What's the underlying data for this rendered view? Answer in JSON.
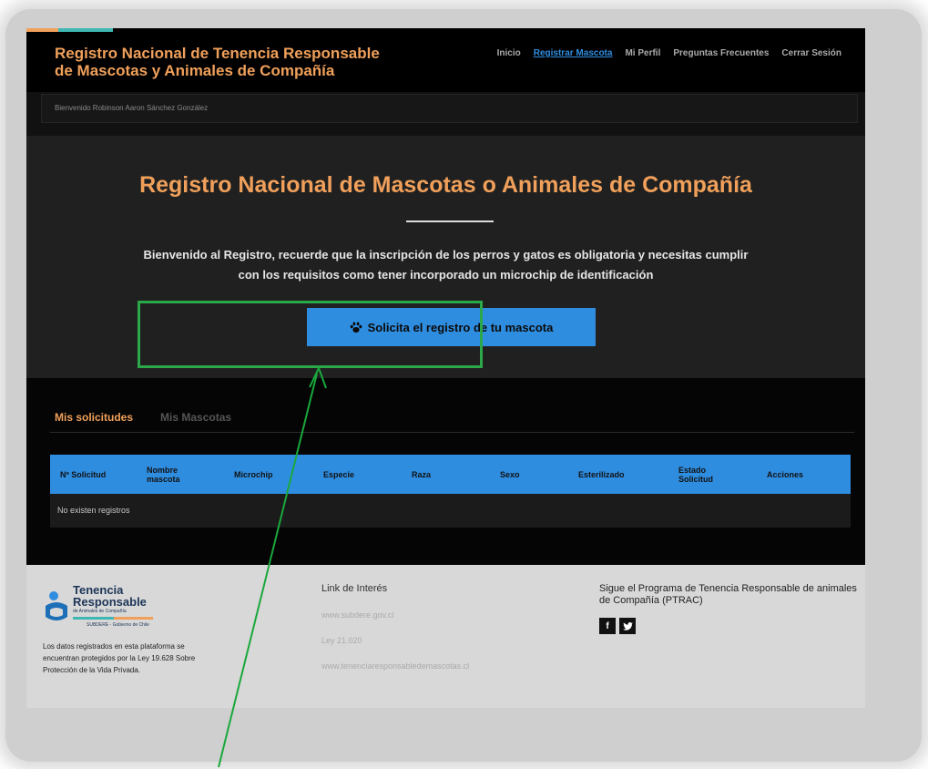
{
  "header": {
    "brand": "Registro Nacional de Tenencia Responsable\nde Mascotas y Animales de Compañía",
    "nav": [
      {
        "label": "Inicio",
        "active": false
      },
      {
        "label": "Registrar Mascota",
        "active": true
      },
      {
        "label": "Mi Perfil",
        "active": false
      },
      {
        "label": "Preguntas Frecuentes",
        "active": false
      },
      {
        "label": "Cerrar Sesión",
        "active": false
      }
    ]
  },
  "welcome": "Bienvenido Robinson Aaron Sánchez González",
  "hero": {
    "title": "Registro Nacional de Mascotas o Animales de Compañía",
    "text": "Bienvenido al Registro, recuerde que la inscripción de los perros y gatos es obligatoria y necesitas cumplir con los requisitos como tener incorporado un microchip de identificación",
    "button_label": "Solicita el registro de tu mascota",
    "button_icon": "paw-icon"
  },
  "tabs": [
    {
      "label": "Mis solicitudes",
      "active": true
    },
    {
      "label": "Mis Mascotas",
      "active": false
    }
  ],
  "table": {
    "columns": [
      "Nº Solicitud",
      "Nombre mascota",
      "Microchip",
      "Especie",
      "Raza",
      "Sexo",
      "Esterilizado",
      "Estado Solicitud",
      "Acciones"
    ],
    "empty_text": "No existen registros"
  },
  "footer": {
    "logo_line1": "Tenencia",
    "logo_line2": "Responsable",
    "logo_line3": "de Animales de Compañía",
    "logo_line4": "SUBDERE - Gobierno de Chile",
    "privacy": "Los datos registrados en esta plataforma se encuentran protegidos por la Ley 19.628 Sobre Protección de la Vida Privada.",
    "links_title": "Link de Interés",
    "links": [
      "www.subdere.gov.cl",
      "Ley 21.020",
      "www.tenenciaresponsabledemascotas.cl"
    ],
    "social_title": "Sigue el Programa de Tenencia Responsable de animales de Compañía (PTRAC)",
    "social": [
      {
        "icon": "facebook-icon",
        "glyph": "f"
      },
      {
        "icon": "twitter-icon",
        "glyph": "𝕥"
      }
    ]
  },
  "colors": {
    "accent_orange": "#f0a05a",
    "accent_blue": "#2f8de0",
    "highlight_green": "#2ba84a",
    "arrow_green": "#1aa83c"
  }
}
